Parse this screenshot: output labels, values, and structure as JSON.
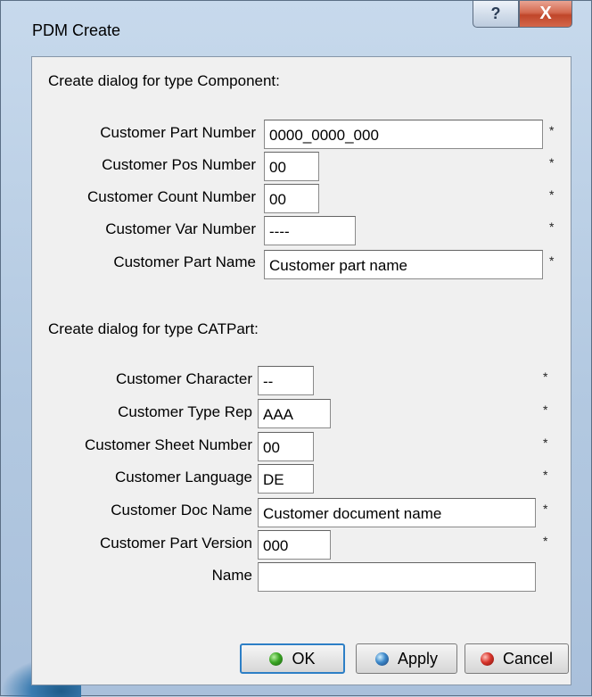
{
  "window": {
    "title": "PDM Create",
    "help_label": "?",
    "close_label": "X"
  },
  "component_section": {
    "heading": "Create dialog for type Component:",
    "fields": [
      {
        "label": "Customer Part Number",
        "value": "0000_0000_000",
        "required": "*"
      },
      {
        "label": "Customer Pos Number",
        "value": "00",
        "required": "*"
      },
      {
        "label": "Customer Count Number",
        "value": "00",
        "required": "*"
      },
      {
        "label": "Customer Var Number",
        "value": "----",
        "required": "*"
      },
      {
        "label": "Customer Part Name",
        "value": "Customer part name",
        "required": "*"
      }
    ]
  },
  "catpart_section": {
    "heading": "Create dialog for type CATPart:",
    "fields": [
      {
        "label": "Customer Character",
        "value": "--",
        "required": "*"
      },
      {
        "label": "Customer Type Rep",
        "value": "AAA",
        "required": "*"
      },
      {
        "label": "Customer Sheet Number",
        "value": "00",
        "required": "*"
      },
      {
        "label": "Customer Language",
        "value": "DE",
        "required": "*"
      },
      {
        "label": "Customer Doc Name",
        "value": "Customer document name",
        "required": "*"
      },
      {
        "label": "Customer Part Version",
        "value": "000",
        "required": "*"
      },
      {
        "label": "Name",
        "value": ""
      }
    ]
  },
  "buttons": {
    "ok": "OK",
    "apply": "Apply",
    "cancel": "Cancel"
  }
}
